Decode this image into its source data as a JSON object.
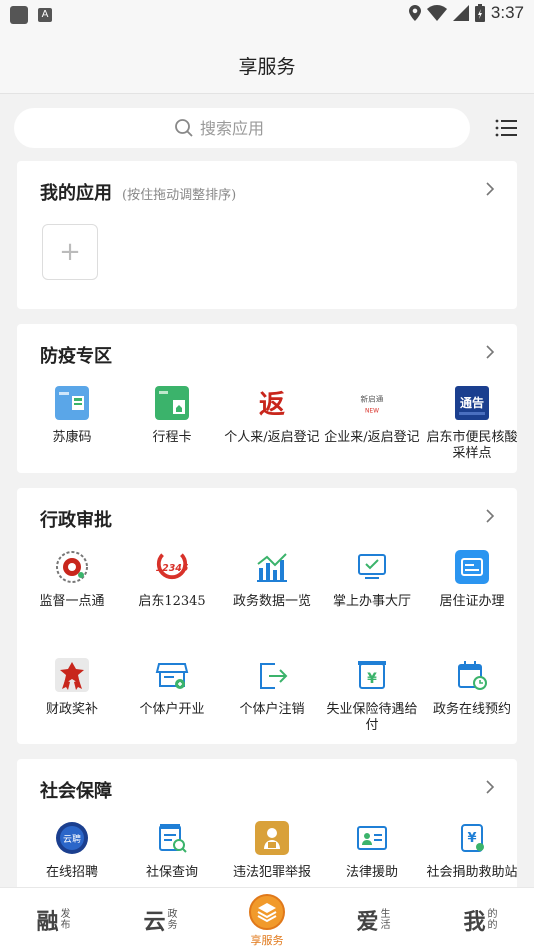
{
  "status_bar": {
    "time": "3:37",
    "badge": "A"
  },
  "header": {
    "title": "享服务"
  },
  "search": {
    "placeholder": "搜索应用"
  },
  "my_apps": {
    "title": "我的应用",
    "subtitle": "(按住拖动调整排序)",
    "add_symbol": "+"
  },
  "epidemic": {
    "title": "防疫专区",
    "items": [
      {
        "label": "苏康码",
        "icon": "sukang-code-icon"
      },
      {
        "label": "行程卡",
        "icon": "travel-card-icon"
      },
      {
        "label": "个人来/返启登记",
        "icon": "personal-return-icon",
        "icon_text": "返"
      },
      {
        "label": "企业来/返启登记",
        "icon": "enterprise-return-icon",
        "icon_text": "新启通",
        "icon_sub": "NEW"
      },
      {
        "label": "启东市便民核酸采样点",
        "icon": "notice-icon",
        "icon_text": "通告"
      }
    ]
  },
  "admin": {
    "title": "行政审批",
    "items": [
      {
        "label": "监督一点通",
        "icon": "supervision-icon"
      },
      {
        "label": "启东12345",
        "icon": "hotline-12345-icon",
        "icon_text": "12345"
      },
      {
        "label": "政务数据一览",
        "icon": "data-chart-icon"
      },
      {
        "label": "掌上办事大厅",
        "icon": "online-hall-icon"
      },
      {
        "label": "居住证办理",
        "icon": "residence-permit-icon"
      },
      {
        "label": "财政奖补",
        "icon": "finance-award-icon"
      },
      {
        "label": "个体户开业",
        "icon": "shop-open-icon"
      },
      {
        "label": "个体户注销",
        "icon": "logout-icon"
      },
      {
        "label": "失业保险待遇给付",
        "icon": "unemployment-icon",
        "icon_text": "¥"
      },
      {
        "label": "政务在线预约",
        "icon": "calendar-icon"
      }
    ]
  },
  "social": {
    "title": "社会保障",
    "items": [
      {
        "label": "在线招聘",
        "icon": "recruit-icon",
        "icon_text": "云聘"
      },
      {
        "label": "社保查询",
        "icon": "social-security-query-icon"
      },
      {
        "label": "违法犯罪举报",
        "icon": "report-icon"
      },
      {
        "label": "法律援助",
        "icon": "legal-aid-icon"
      },
      {
        "label": "社会捐助救助站",
        "icon": "donation-icon",
        "icon_text": "¥"
      }
    ]
  },
  "bottom_nav": [
    {
      "main": "融",
      "sub1": "发",
      "sub2": "布"
    },
    {
      "main": "云",
      "sub1": "政",
      "sub2": "务"
    },
    {
      "main": "享服务"
    },
    {
      "main": "爱",
      "sub1": "生",
      "sub2": "活"
    },
    {
      "main": "我",
      "sub1": "的",
      "sub2": "的"
    }
  ],
  "colors": {
    "accent": "#e0781a",
    "blue": "#1f7fd6",
    "green": "#3bb36b",
    "red": "#d8322a"
  }
}
